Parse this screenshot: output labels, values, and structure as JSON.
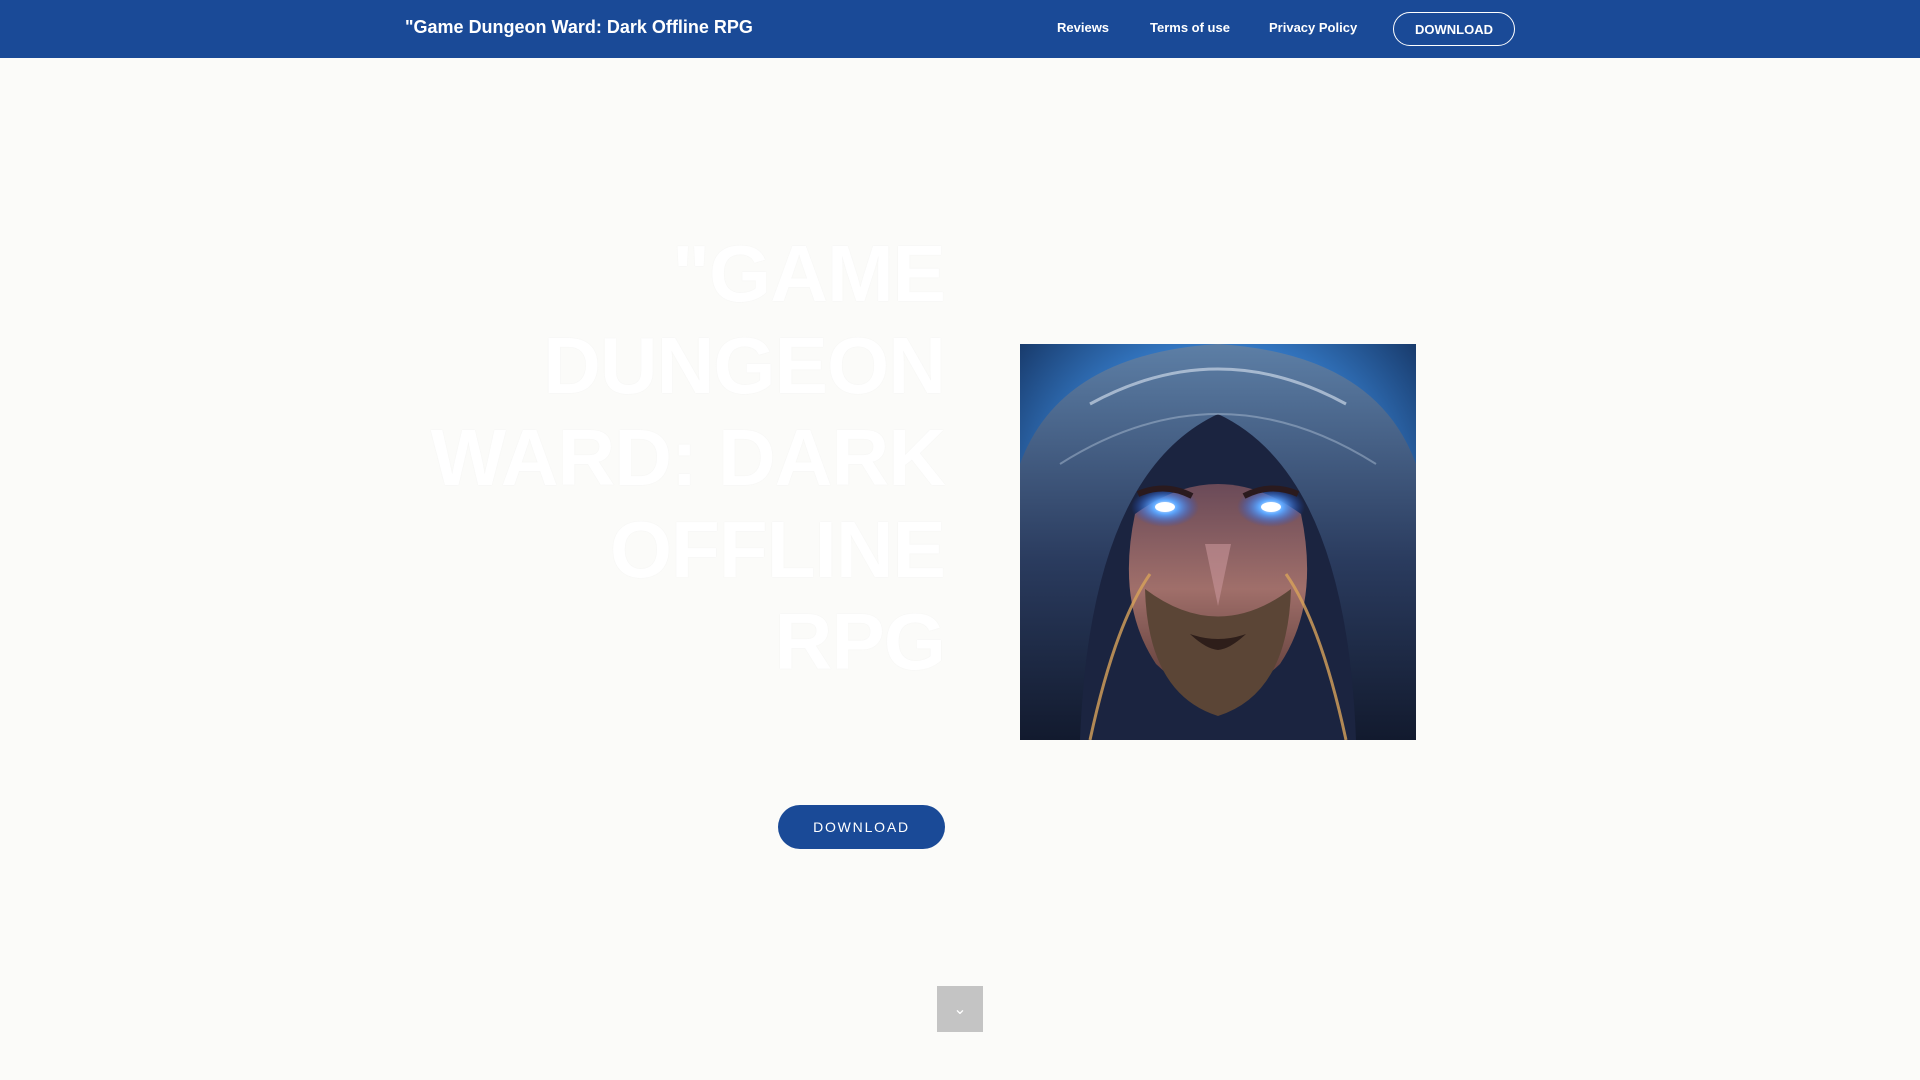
{
  "nav": {
    "brand": "\"Game Dungeon Ward: Dark Offline RPG",
    "links": [
      "Reviews",
      "Terms of use",
      "Privacy Policy"
    ],
    "download_label": "DOWNLOAD"
  },
  "hero": {
    "title": "\"GAME DUNGEON WARD: DARK OFFLINE RPG",
    "download_label": "DOWNLOAD",
    "image_icon": "hooded-warrior-image"
  },
  "scroll": {
    "icon": "chevron-down-icon",
    "glyph": "⌄"
  },
  "colors": {
    "brand_blue": "#1a4a97",
    "page_bg": "#fbfbf9",
    "scroll_button": "#c4c4c4"
  }
}
